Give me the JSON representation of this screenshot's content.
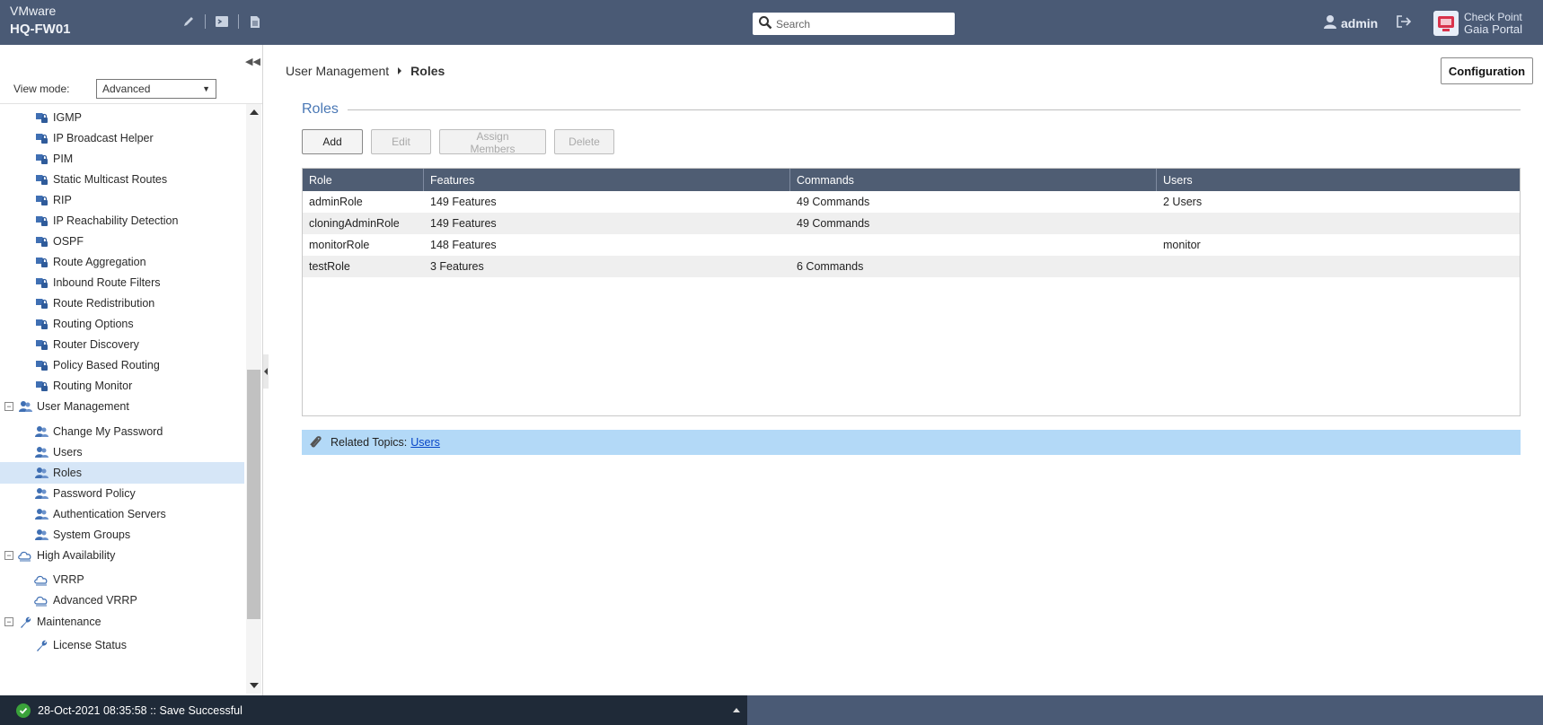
{
  "header": {
    "platform": "VMware",
    "hostname": "HQ-FW01",
    "search_placeholder": "Search",
    "username": "admin",
    "brand_line1": "Check Point",
    "brand_line2": "Gaia Portal"
  },
  "sidebar": {
    "view_mode_label": "View mode:",
    "view_mode_value": "Advanced",
    "items": [
      {
        "label": "IGMP",
        "type": "child",
        "icon": "lock-network-icon"
      },
      {
        "label": "IP Broadcast Helper",
        "type": "child",
        "icon": "lock-network-icon"
      },
      {
        "label": "PIM",
        "type": "child",
        "icon": "lock-network-icon"
      },
      {
        "label": "Static Multicast Routes",
        "type": "child",
        "icon": "lock-network-icon"
      },
      {
        "label": "RIP",
        "type": "child",
        "icon": "lock-network-icon"
      },
      {
        "label": "IP Reachability Detection",
        "type": "child",
        "icon": "lock-network-icon"
      },
      {
        "label": "OSPF",
        "type": "child",
        "icon": "lock-network-icon"
      },
      {
        "label": "Route Aggregation",
        "type": "child",
        "icon": "lock-network-icon"
      },
      {
        "label": "Inbound Route Filters",
        "type": "child",
        "icon": "lock-network-icon"
      },
      {
        "label": "Route Redistribution",
        "type": "child",
        "icon": "lock-network-icon"
      },
      {
        "label": "Routing Options",
        "type": "child",
        "icon": "lock-network-icon"
      },
      {
        "label": "Router Discovery",
        "type": "child",
        "icon": "lock-network-icon"
      },
      {
        "label": "Policy Based Routing",
        "type": "child",
        "icon": "lock-network-icon"
      },
      {
        "label": "Routing Monitor",
        "type": "child",
        "icon": "lock-network-icon"
      },
      {
        "label": "User Management",
        "type": "parent",
        "icon": "users-icon"
      },
      {
        "label": "Change My Password",
        "type": "child",
        "icon": "users-icon"
      },
      {
        "label": "Users",
        "type": "child",
        "icon": "users-icon"
      },
      {
        "label": "Roles",
        "type": "child",
        "icon": "users-icon",
        "selected": true
      },
      {
        "label": "Password Policy",
        "type": "child",
        "icon": "users-icon"
      },
      {
        "label": "Authentication Servers",
        "type": "child",
        "icon": "users-icon"
      },
      {
        "label": "System Groups",
        "type": "child",
        "icon": "users-icon"
      },
      {
        "label": "High Availability",
        "type": "parent",
        "icon": "cloud-icon"
      },
      {
        "label": "VRRP",
        "type": "child",
        "icon": "cloud-icon"
      },
      {
        "label": "Advanced VRRP",
        "type": "child",
        "icon": "cloud-icon"
      },
      {
        "label": "Maintenance",
        "type": "parent",
        "icon": "wrench-icon"
      },
      {
        "label": "License Status",
        "type": "child",
        "icon": "wrench-icon"
      }
    ]
  },
  "breadcrumb": {
    "parent": "User Management",
    "current": "Roles"
  },
  "main": {
    "config_button": "Configuration",
    "section_title": "Roles",
    "buttons": {
      "add": "Add",
      "edit": "Edit",
      "assign": "Assign Members",
      "delete": "Delete"
    },
    "table": {
      "columns": [
        "Role",
        "Features",
        "Commands",
        "Users"
      ],
      "rows": [
        [
          "adminRole",
          "149 Features",
          "49 Commands",
          "2 Users"
        ],
        [
          "cloningAdminRole",
          "149 Features",
          "49 Commands",
          ""
        ],
        [
          "monitorRole",
          "148 Features",
          "",
          "monitor"
        ],
        [
          "testRole",
          "3 Features",
          "6 Commands",
          ""
        ]
      ]
    },
    "related": {
      "label": "Related Topics:",
      "link": "Users"
    }
  },
  "statusbar": {
    "message": "28-Oct-2021 08:35:58 :: Save Successful"
  },
  "colors": {
    "header_bg": "#4a5a75",
    "accent": "#4a78b5",
    "selected_row": "#d6e6f7",
    "related_bg": "#b3d9f7"
  }
}
